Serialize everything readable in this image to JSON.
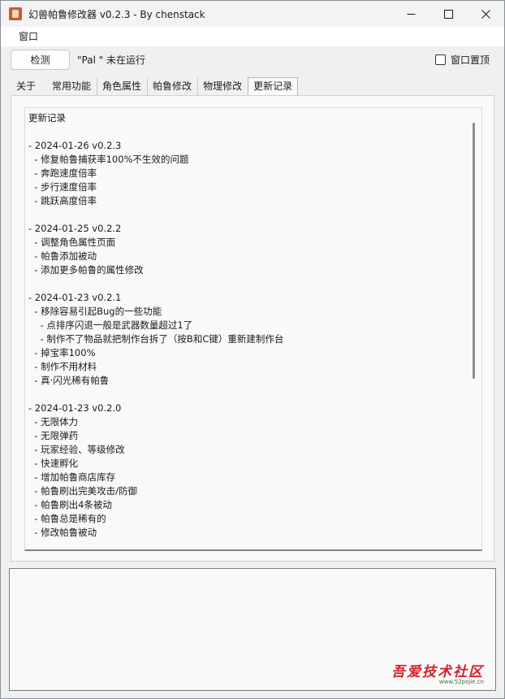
{
  "window": {
    "title": "幻兽帕鲁修改器 v0.2.3 - By chenstack"
  },
  "menu": {
    "items": [
      "窗口"
    ]
  },
  "toolbar": {
    "detect_label": "检测",
    "status": "\"Pal  \" 未在运行",
    "ontop_label": "窗口置顶",
    "ontop_checked": false
  },
  "tabs": [
    {
      "label": "关于",
      "active": false
    },
    {
      "label": "常用功能",
      "active": false
    },
    {
      "label": "角色属性",
      "active": false
    },
    {
      "label": "帕鲁修改",
      "active": false
    },
    {
      "label": "物理修改",
      "active": false
    },
    {
      "label": "更新记录",
      "active": true
    }
  ],
  "changelog": {
    "lines": [
      "更新记录",
      "",
      "- 2024-01-26 v0.2.3",
      "  - 修复帕鲁捕获率100%不生效的问题",
      "  - 奔跑速度倍率",
      "  - 步行速度倍率",
      "  - 跳跃高度倍率",
      "",
      "- 2024-01-25 v0.2.2",
      "  - 调整角色属性页面",
      "  - 帕鲁添加被动",
      "  - 添加更多帕鲁的属性修改",
      "",
      "- 2024-01-23 v0.2.1",
      "  - 移除容易引起Bug的一些功能",
      "    - 点排序闪退一般是武器数量超过1了",
      "    - 制作不了物品就把制作台拆了（按B和C键）重新建制作台",
      "  - 掉宝率100%",
      "  - 制作不用材料",
      "  - 真·闪光稀有帕鲁",
      "",
      "- 2024-01-23 v0.2.0",
      "  - 无限体力",
      "  - 无限弹药",
      "  - 玩家经验、等级修改",
      "  - 快速孵化",
      "  - 增加帕鲁商店库存",
      "  - 帕鲁刷出完美攻击/防御",
      "  - 帕鲁刷出4条被动",
      "  - 帕鲁总是稀有的",
      "  - 修改帕鲁被动"
    ]
  },
  "output": {
    "text": ""
  },
  "watermark": {
    "main": "吾爱技术社区",
    "sub": "www.52pojie.cn"
  }
}
